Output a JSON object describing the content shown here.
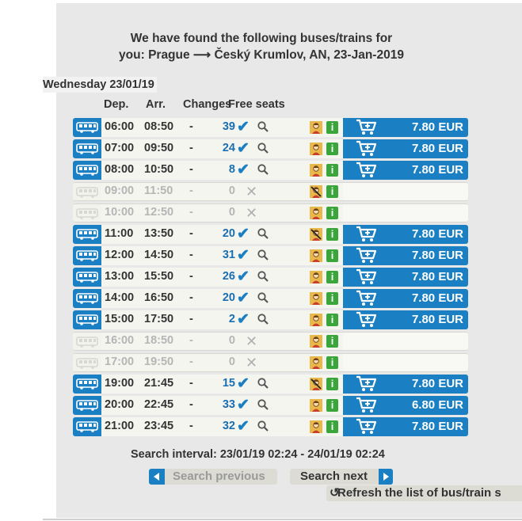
{
  "header": {
    "line1": "We have found the following buses/trains for",
    "line2": "you: Prague ⟶ Český Krumlov, AN, 23-Jan-2019"
  },
  "date_label": "Wednesday 23/01/19",
  "columns": {
    "dep": "Dep.",
    "arr": "Arr.",
    "changes": "Changes",
    "free_seats": "Free seats"
  },
  "rows": [
    {
      "dep": "06:00",
      "arr": "08:50",
      "changes": "-",
      "seats": "39",
      "available": true,
      "price": "7.80 EUR",
      "face": "normal"
    },
    {
      "dep": "07:00",
      "arr": "09:50",
      "changes": "-",
      "seats": "24",
      "available": true,
      "price": "7.80 EUR",
      "face": "normal"
    },
    {
      "dep": "08:00",
      "arr": "10:50",
      "changes": "-",
      "seats": "8",
      "available": true,
      "price": "7.80 EUR",
      "face": "normal"
    },
    {
      "dep": "09:00",
      "arr": "11:50",
      "changes": "-",
      "seats": "0",
      "available": false,
      "price": "",
      "face": "crossed"
    },
    {
      "dep": "10:00",
      "arr": "12:50",
      "changes": "-",
      "seats": "0",
      "available": false,
      "price": "",
      "face": "normal"
    },
    {
      "dep": "11:00",
      "arr": "13:50",
      "changes": "-",
      "seats": "20",
      "available": true,
      "price": "7.80 EUR",
      "face": "crossed"
    },
    {
      "dep": "12:00",
      "arr": "14:50",
      "changes": "-",
      "seats": "31",
      "available": true,
      "price": "7.80 EUR",
      "face": "normal"
    },
    {
      "dep": "13:00",
      "arr": "15:50",
      "changes": "-",
      "seats": "26",
      "available": true,
      "price": "7.80 EUR",
      "face": "normal"
    },
    {
      "dep": "14:00",
      "arr": "16:50",
      "changes": "-",
      "seats": "20",
      "available": true,
      "price": "7.80 EUR",
      "face": "normal"
    },
    {
      "dep": "15:00",
      "arr": "17:50",
      "changes": "-",
      "seats": "2",
      "available": true,
      "price": "7.80 EUR",
      "face": "normal"
    },
    {
      "dep": "16:00",
      "arr": "18:50",
      "changes": "-",
      "seats": "0",
      "available": false,
      "price": "",
      "face": "normal"
    },
    {
      "dep": "17:00",
      "arr": "19:50",
      "changes": "-",
      "seats": "0",
      "available": false,
      "price": "",
      "face": "normal"
    },
    {
      "dep": "19:00",
      "arr": "21:45",
      "changes": "-",
      "seats": "15",
      "available": true,
      "price": "7.80 EUR",
      "face": "crossed"
    },
    {
      "dep": "20:00",
      "arr": "22:45",
      "changes": "-",
      "seats": "33",
      "available": true,
      "price": "6.80 EUR",
      "face": "normal"
    },
    {
      "dep": "21:00",
      "arr": "23:45",
      "changes": "-",
      "seats": "32",
      "available": true,
      "price": "7.80 EUR",
      "face": "normal"
    }
  ],
  "footer": {
    "interval": "Search interval: 23/01/19 02:24 - 24/01/19 02:24",
    "search_previous": "Search previous",
    "search_next": "Search next",
    "refresh": "Refresh the list of bus/train s"
  },
  "colors": {
    "accent": "#1b7fc3",
    "info_green": "#3aa53a",
    "panel_bg": "#e8e8e8"
  }
}
